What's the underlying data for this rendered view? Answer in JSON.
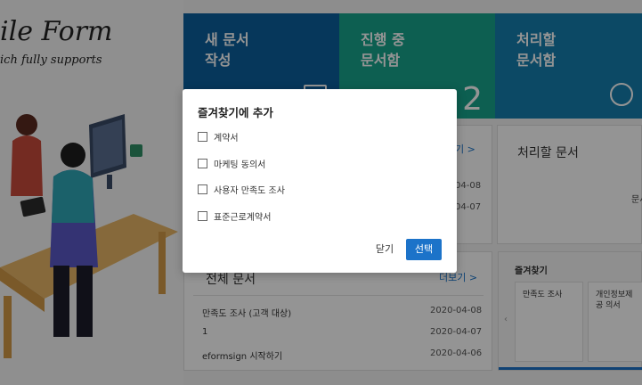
{
  "hero": {
    "title": "ile Form",
    "subtitle": "ich fully supports"
  },
  "tiles": [
    {
      "line1": "새 문서",
      "line2": "작성",
      "count": "",
      "color": "#0c5f9e"
    },
    {
      "line1": "진행 중",
      "line2": "문서함",
      "count": "2",
      "color": "#18a48c"
    },
    {
      "line1": "처리할",
      "line2": "문서함",
      "count": "",
      "color": "#157fae"
    }
  ],
  "recent_panel": {
    "more": "기 >",
    "dates": [
      "04-08",
      "04-07"
    ]
  },
  "pending_panel": {
    "title": "처리할 문서",
    "empty_text": "문서"
  },
  "all_docs_panel": {
    "title": "전체 문서",
    "more": "더보기 >",
    "rows": [
      {
        "name": "만족도 조사 (고객 대상)",
        "date": "2020-04-08"
      },
      {
        "name": "1",
        "date": "2020-04-07"
      },
      {
        "name": "eformsign 시작하기",
        "date": "2020-04-06"
      }
    ]
  },
  "favorites_panel": {
    "title": "즐겨찾기",
    "cards": [
      {
        "label": "만족도 조사"
      },
      {
        "label": "개인정보제공 의서"
      }
    ]
  },
  "modal": {
    "title": "즐겨찾기에 추가",
    "options": [
      {
        "label": "계약서",
        "checked": false
      },
      {
        "label": "마케팅 동의서",
        "checked": false
      },
      {
        "label": "사용자 만족도 조사",
        "checked": false
      },
      {
        "label": "표준근로계약서",
        "checked": false
      }
    ],
    "close_label": "닫기",
    "select_label": "선택"
  }
}
